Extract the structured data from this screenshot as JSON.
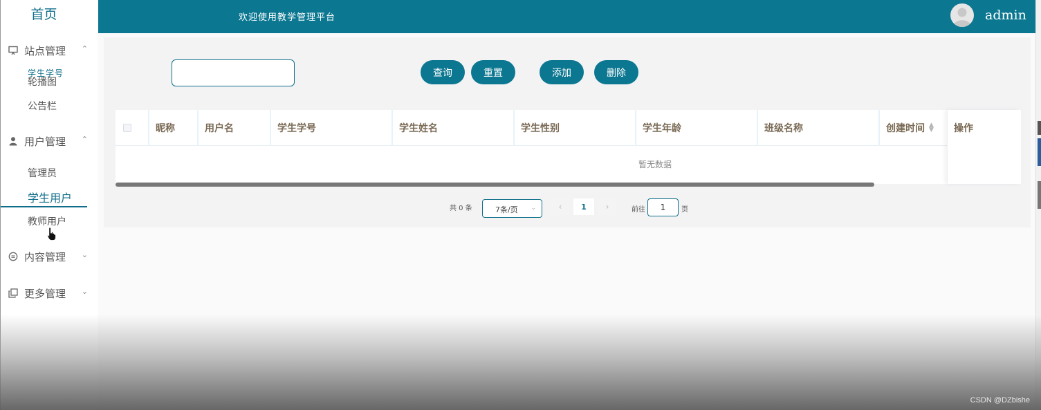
{
  "sidebar": {
    "home": "首页",
    "groups": [
      {
        "label": "站点管理",
        "icon": "monitor-icon",
        "chevron": "⌃",
        "items": [
          "轮播图",
          "公告栏"
        ]
      },
      {
        "label": "用户管理",
        "icon": "user-icon",
        "chevron": "⌃",
        "items": [
          "管理员",
          "学生用户",
          "教师用户"
        ]
      },
      {
        "label": "内容管理",
        "icon": "chat-icon",
        "chevron": "⌄",
        "items": []
      },
      {
        "label": "更多管理",
        "icon": "copy-icon",
        "chevron": "⌄",
        "items": []
      }
    ],
    "active_item": "学生用户"
  },
  "header": {
    "welcome": "欢迎使用教学管理平台",
    "username": "admin"
  },
  "search": {
    "label": "学生学号",
    "value": "",
    "buttons": {
      "query": "查询",
      "reset": "重置",
      "add": "添加",
      "delete": "删除"
    }
  },
  "table": {
    "columns": [
      "昵称",
      "用户名",
      "学生学号",
      "学生姓名",
      "学生性别",
      "学生年龄",
      "班级名称",
      "创建时间",
      "操作"
    ],
    "rows": [],
    "empty_text": "暂无数据"
  },
  "pagination": {
    "total_text": "共 0 条",
    "page_size": "7条/页",
    "current_page": "1",
    "goto_prefix": "前往",
    "goto_value": "1",
    "goto_suffix": "页"
  },
  "watermark": "CSDN @DZbishe",
  "colors": {
    "primary": "#0b7791",
    "sidebar_text": "#555555",
    "header_text": "#7a6a55"
  }
}
